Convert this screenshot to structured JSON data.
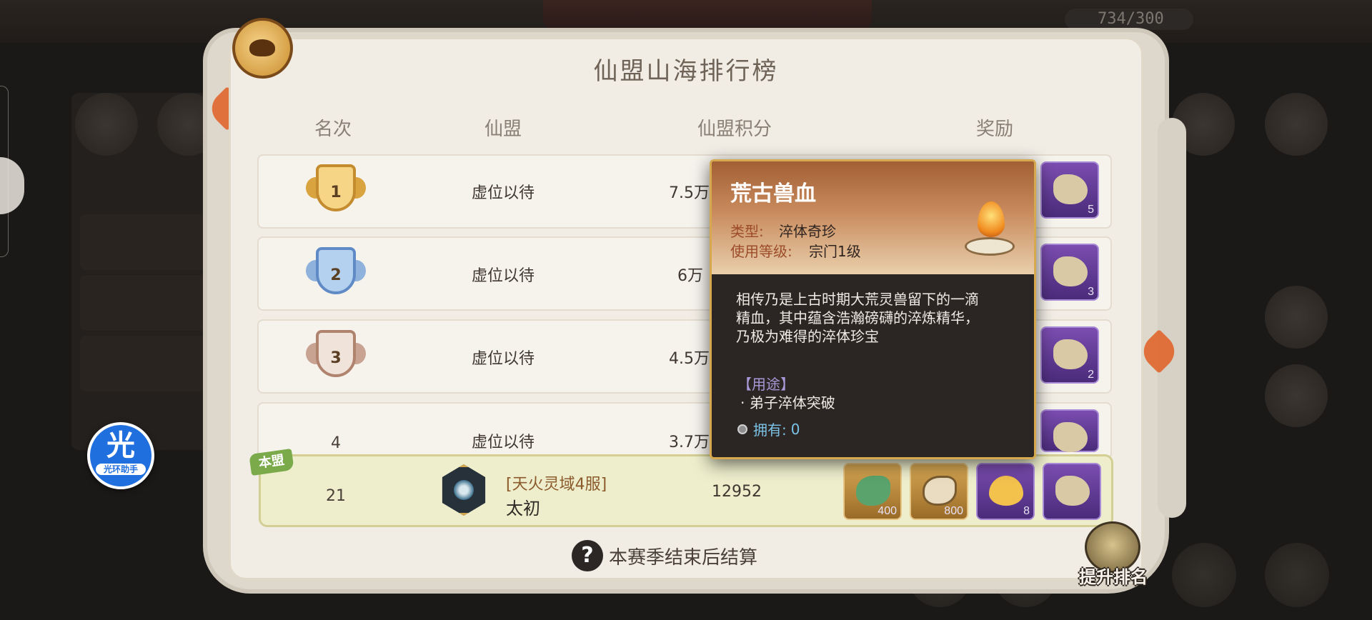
{
  "background": {
    "currency_text": "734/300"
  },
  "helper": {
    "glyph": "光",
    "label": "光环助手"
  },
  "panel": {
    "title": "仙盟山海排行榜",
    "headers": {
      "rank": "名次",
      "alliance": "仙盟",
      "score": "仙盟积分",
      "reward": "奖励"
    }
  },
  "rows": [
    {
      "rank": "1",
      "alliance": "虚位以待",
      "score": "7.5万",
      "reward_qty": "5"
    },
    {
      "rank": "2",
      "alliance": "虚位以待",
      "score": "6万",
      "reward_qty": "3"
    },
    {
      "rank": "3",
      "alliance": "虚位以待",
      "score": "4.5万",
      "reward_qty": "2"
    },
    {
      "rank": "4",
      "alliance": "虚位以待",
      "score": "3.7万",
      "reward_qty": ""
    }
  ],
  "my_alliance": {
    "tag": "本盟",
    "rank": "21",
    "server": "[天火灵域4服]",
    "name": "太初",
    "score": "12952",
    "rewards": [
      {
        "qty": "400"
      },
      {
        "qty": "800"
      },
      {
        "qty": "8"
      },
      {
        "qty": ""
      }
    ]
  },
  "footer": {
    "note": "本赛季结束后结算",
    "boost_label": "提升排名"
  },
  "tooltip": {
    "title": "荒古兽血",
    "type_label": "类型:",
    "type_value": "淬体奇珍",
    "level_label": "使用等级:",
    "level_value": "宗门1级",
    "desc_line1": "相传乃是上古时期大荒灵兽留下的一滴",
    "desc_line2": "精血，其中蕴含浩瀚磅礴的淬炼精华，",
    "desc_line3": "乃极为难得的淬体珍宝",
    "usage_head": "【用途】",
    "usage_item": "· 弟子淬体突破",
    "owned_label": "拥有:",
    "owned_value": "0"
  },
  "colors": {
    "panel_bg": "#f1ede5",
    "tooltip_border": "#d7a94f",
    "mine_row": "#eeeecd",
    "reward_purple": "#7b4db0"
  }
}
